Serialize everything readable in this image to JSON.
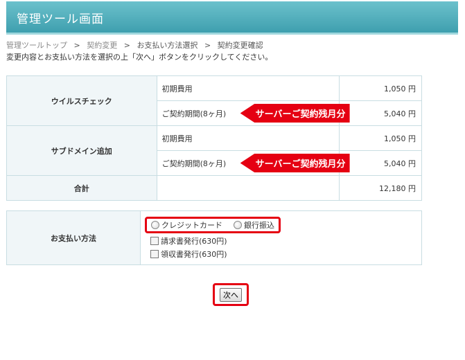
{
  "header": {
    "title": "管理ツール画面"
  },
  "breadcrumb": {
    "items": [
      "管理ツールトップ",
      "契約変更",
      "お支払い方法選択",
      "契約変更確認"
    ],
    "separator": ">"
  },
  "instruction": "変更内容とお支払い方法を選択の上「次へ」ボタンをクリックしてください。",
  "fees": {
    "rows": [
      {
        "name": "ウイルスチェック",
        "items": [
          {
            "label": "初期費用",
            "amount": "1,050 円"
          },
          {
            "label": "ご契約期間(8ヶ月)",
            "amount": "5,040 円",
            "callout": "サーバーご契約残月分"
          }
        ]
      },
      {
        "name": "サブドメイン追加",
        "items": [
          {
            "label": "初期費用",
            "amount": "1,050 円"
          },
          {
            "label": "ご契約期間(8ヶ月)",
            "amount": "5,040 円",
            "callout": "サーバーご契約残月分"
          }
        ]
      }
    ],
    "total_label": "合計",
    "total_amount": "12,180 円"
  },
  "payment": {
    "label": "お支払い方法",
    "radios": [
      "クレジットカード",
      "銀行振込"
    ],
    "checkboxes": [
      "請求書発行(630円)",
      "領収書発行(630円)"
    ]
  },
  "next_button": {
    "label": "次へ"
  },
  "colors": {
    "header": "#4fb0bd",
    "highlight": "#e50012",
    "border": "#c8dde2",
    "head_bg": "#f0f6f8"
  }
}
